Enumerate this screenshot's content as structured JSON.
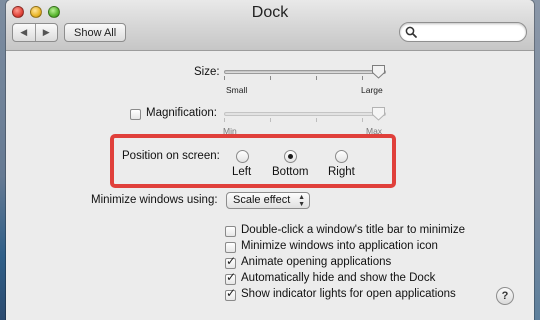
{
  "window": {
    "title": "Dock"
  },
  "toolbar": {
    "back_glyph": "◀",
    "forward_glyph": "▶",
    "show_all_label": "Show All",
    "search_value": "",
    "search_placeholder": ""
  },
  "size": {
    "label": "Size:",
    "min_label": "Small",
    "max_label": "Large",
    "level": 1.0
  },
  "magnification": {
    "label": "Magnification:",
    "checked": false,
    "min_label": "Min",
    "max_label": "Max",
    "level": 1.0,
    "enabled": false
  },
  "position": {
    "label": "Position on screen:",
    "options": [
      "Left",
      "Bottom",
      "Right"
    ],
    "selected": "Bottom"
  },
  "minimize": {
    "label": "Minimize windows using:",
    "selected": "Scale effect"
  },
  "checkboxes": [
    {
      "label": "Double-click a window's title bar to minimize",
      "checked": false
    },
    {
      "label": "Minimize windows into application icon",
      "checked": false
    },
    {
      "label": "Animate opening applications",
      "checked": true
    },
    {
      "label": "Automatically hide and show the Dock",
      "checked": true
    },
    {
      "label": "Show indicator lights for open applications",
      "checked": true
    }
  ],
  "help": {
    "label": "?"
  },
  "colors": {
    "highlight_border": "#e0403b",
    "window_background": "#ececec"
  }
}
